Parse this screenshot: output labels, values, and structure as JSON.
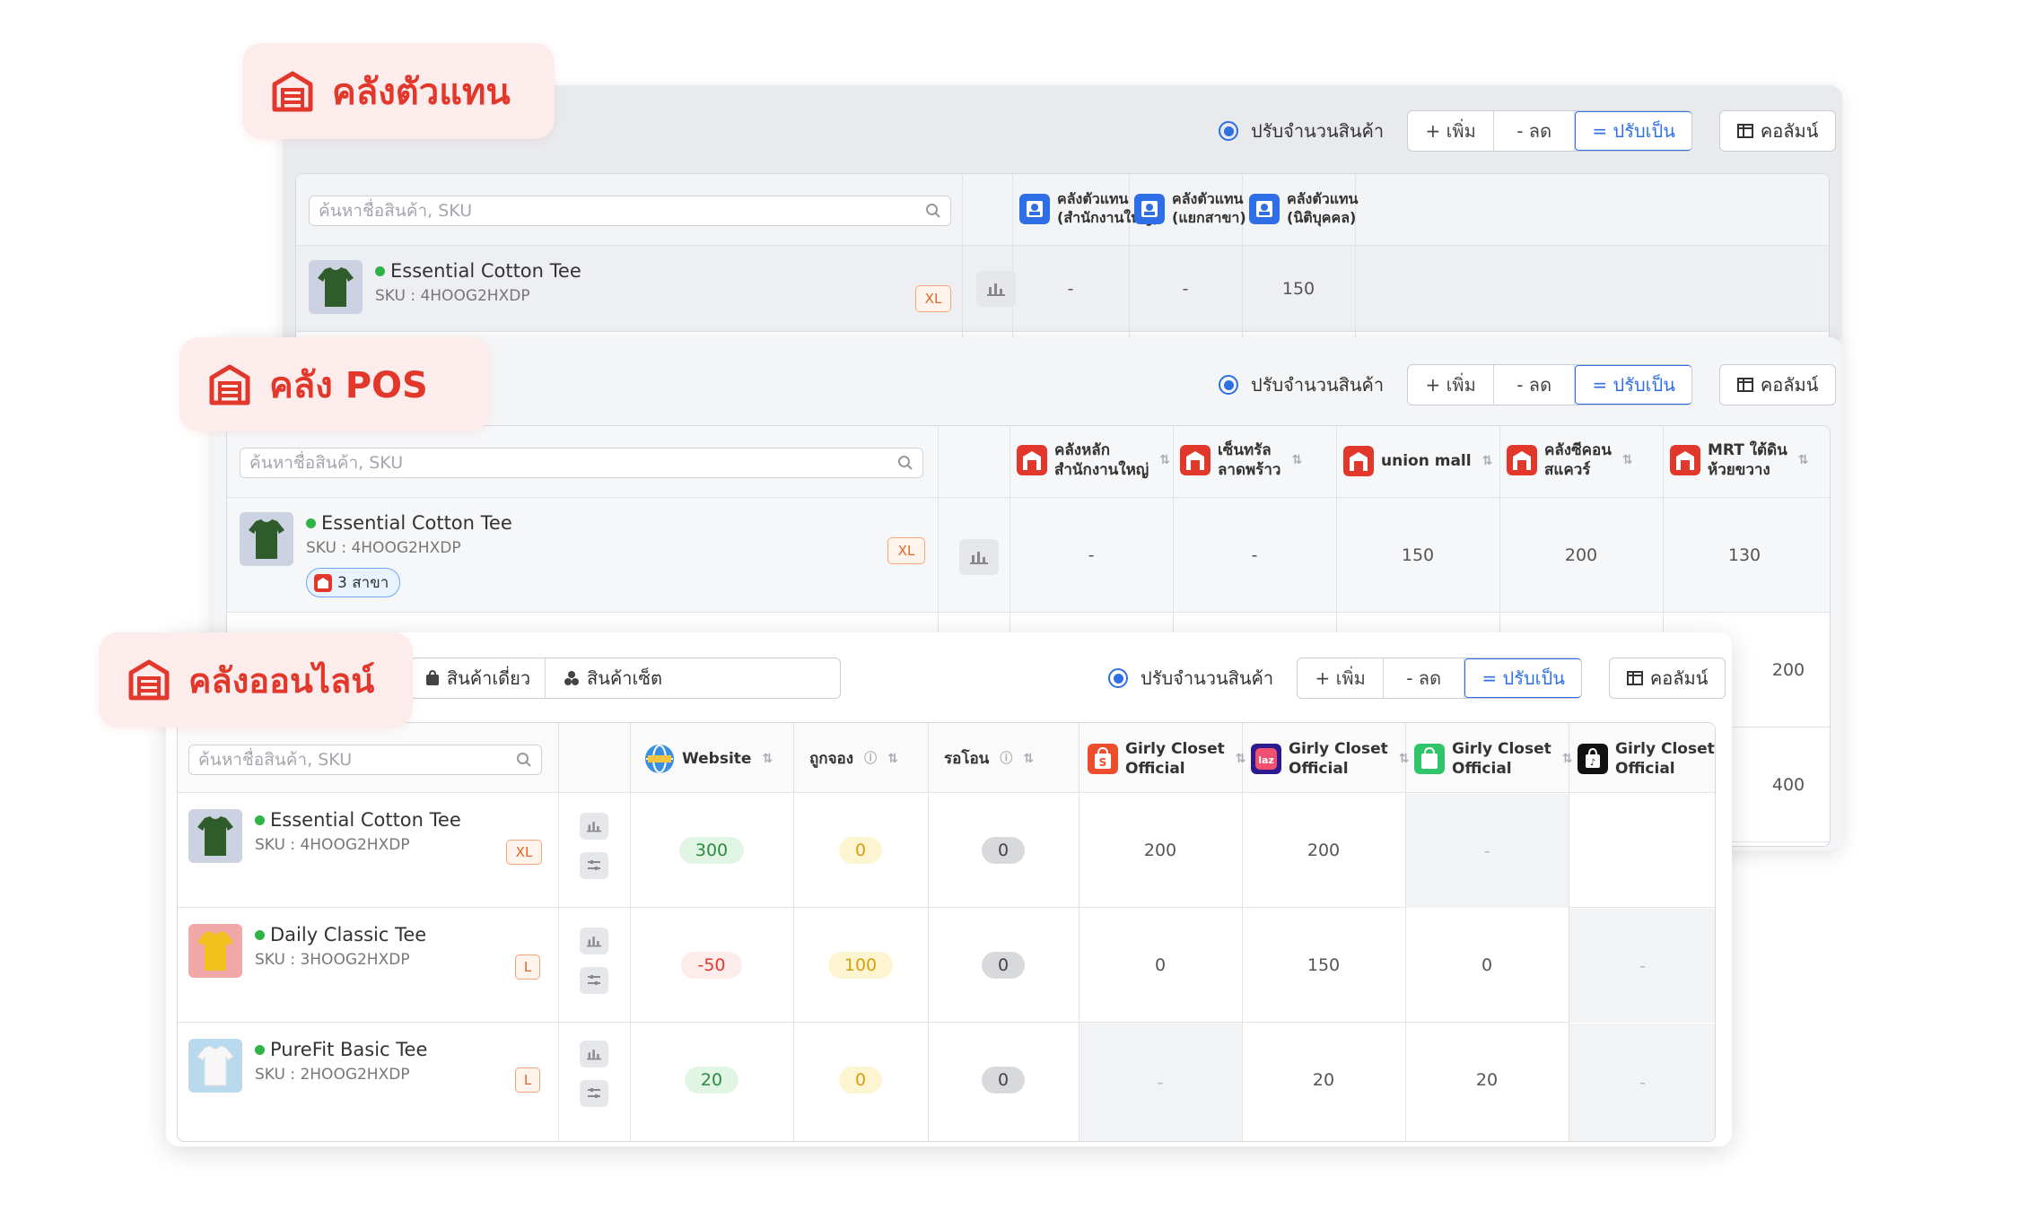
{
  "tags": {
    "proxy": "คลังตัวแทน",
    "pos": "คลัง POS",
    "online": "คลังออนไลน์"
  },
  "toolbar": {
    "adjust_label": "ปรับจำนวนสินค้า",
    "add": "+ เพิ่ม",
    "reduce": "- ลด",
    "set": "= ปรับเป็น",
    "columns": "คอลัมน์"
  },
  "search_placeholder": "ค้นหาชื่อสินค้า, SKU",
  "proxy_panel": {
    "columns": [
      "คลังตัวแทน\n(สำนักงานใหญ่)",
      "คลังตัวแทน\n(แยกสาขา)",
      "คลังตัวแทน\n(นิติบุคคล)"
    ],
    "product": {
      "name": "Essential Cotton Tee",
      "sku": "SKU : 4HOOG2HXDP",
      "size": "XL"
    },
    "values": [
      "-",
      "-",
      "150"
    ]
  },
  "pos_panel": {
    "columns": [
      "คลังหลัก\nสำนักงานใหญ่",
      "เซ็นทรัล\nลาดพร้าว",
      "union mall",
      "คลังซีคอน\nสแควร์",
      "MRT ใต้ดิน\nห้วยขวาง"
    ],
    "product": {
      "name": "Essential Cotton Tee",
      "sku": "SKU : 4HOOG2HXDP",
      "size": "XL",
      "branches": "3 สาขา"
    },
    "values": [
      "-",
      "-",
      "150",
      "200",
      "130"
    ],
    "peek_values": [
      "200",
      "400"
    ]
  },
  "online_panel": {
    "tabs": [
      "สินค้าเดี่ยว",
      "สินค้าเซ็ต"
    ],
    "columns": {
      "website": "Website",
      "reserved": "ถูกจอง",
      "pending": "รอโอน",
      "channels": [
        "Girly Closet\nOfficial",
        "Girly Closet\nOfficial",
        "Girly Closet\nOfficial",
        "Girly Closet\nOfficial"
      ]
    },
    "rows": [
      {
        "name": "Essential Cotton Tee",
        "sku": "SKU : 4HOOG2HXDP",
        "size": "XL",
        "website": "300",
        "reserved": "0",
        "pending": "0",
        "c1": "200",
        "c2": "200",
        "c3": "-",
        "c4": ""
      },
      {
        "name": "Daily Classic Tee",
        "sku": "SKU : 3HOOG2HXDP",
        "size": "L",
        "website": "-50",
        "reserved": "100",
        "pending": "0",
        "c1": "0",
        "c2": "150",
        "c3": "0",
        "c4": "-"
      },
      {
        "name": "PureFit Basic Tee",
        "sku": "SKU : 2HOOG2HXDP",
        "size": "L",
        "website": "20",
        "reserved": "0",
        "pending": "0",
        "c1": "-",
        "c2": "20",
        "c3": "20",
        "c4": "-"
      }
    ]
  },
  "colors": {
    "accent": "#2f6fe6",
    "brand": "#e2372b",
    "green": "#2fb344"
  }
}
